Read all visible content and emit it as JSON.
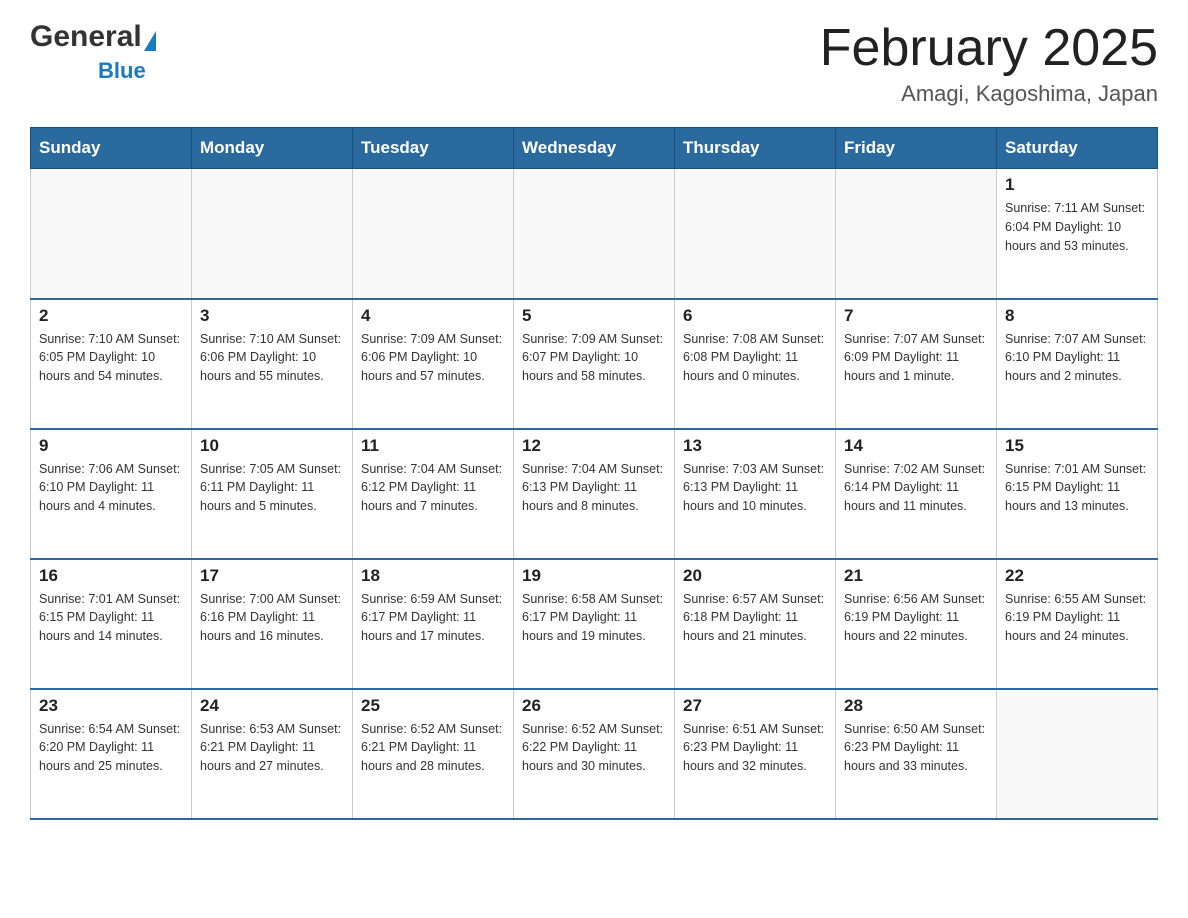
{
  "header": {
    "logo_general": "General",
    "logo_blue": "Blue",
    "title": "February 2025",
    "subtitle": "Amagi, Kagoshima, Japan"
  },
  "weekdays": [
    "Sunday",
    "Monday",
    "Tuesday",
    "Wednesday",
    "Thursday",
    "Friday",
    "Saturday"
  ],
  "weeks": [
    [
      {
        "day": "",
        "info": ""
      },
      {
        "day": "",
        "info": ""
      },
      {
        "day": "",
        "info": ""
      },
      {
        "day": "",
        "info": ""
      },
      {
        "day": "",
        "info": ""
      },
      {
        "day": "",
        "info": ""
      },
      {
        "day": "1",
        "info": "Sunrise: 7:11 AM\nSunset: 6:04 PM\nDaylight: 10 hours\nand 53 minutes."
      }
    ],
    [
      {
        "day": "2",
        "info": "Sunrise: 7:10 AM\nSunset: 6:05 PM\nDaylight: 10 hours\nand 54 minutes."
      },
      {
        "day": "3",
        "info": "Sunrise: 7:10 AM\nSunset: 6:06 PM\nDaylight: 10 hours\nand 55 minutes."
      },
      {
        "day": "4",
        "info": "Sunrise: 7:09 AM\nSunset: 6:06 PM\nDaylight: 10 hours\nand 57 minutes."
      },
      {
        "day": "5",
        "info": "Sunrise: 7:09 AM\nSunset: 6:07 PM\nDaylight: 10 hours\nand 58 minutes."
      },
      {
        "day": "6",
        "info": "Sunrise: 7:08 AM\nSunset: 6:08 PM\nDaylight: 11 hours\nand 0 minutes."
      },
      {
        "day": "7",
        "info": "Sunrise: 7:07 AM\nSunset: 6:09 PM\nDaylight: 11 hours\nand 1 minute."
      },
      {
        "day": "8",
        "info": "Sunrise: 7:07 AM\nSunset: 6:10 PM\nDaylight: 11 hours\nand 2 minutes."
      }
    ],
    [
      {
        "day": "9",
        "info": "Sunrise: 7:06 AM\nSunset: 6:10 PM\nDaylight: 11 hours\nand 4 minutes."
      },
      {
        "day": "10",
        "info": "Sunrise: 7:05 AM\nSunset: 6:11 PM\nDaylight: 11 hours\nand 5 minutes."
      },
      {
        "day": "11",
        "info": "Sunrise: 7:04 AM\nSunset: 6:12 PM\nDaylight: 11 hours\nand 7 minutes."
      },
      {
        "day": "12",
        "info": "Sunrise: 7:04 AM\nSunset: 6:13 PM\nDaylight: 11 hours\nand 8 minutes."
      },
      {
        "day": "13",
        "info": "Sunrise: 7:03 AM\nSunset: 6:13 PM\nDaylight: 11 hours\nand 10 minutes."
      },
      {
        "day": "14",
        "info": "Sunrise: 7:02 AM\nSunset: 6:14 PM\nDaylight: 11 hours\nand 11 minutes."
      },
      {
        "day": "15",
        "info": "Sunrise: 7:01 AM\nSunset: 6:15 PM\nDaylight: 11 hours\nand 13 minutes."
      }
    ],
    [
      {
        "day": "16",
        "info": "Sunrise: 7:01 AM\nSunset: 6:15 PM\nDaylight: 11 hours\nand 14 minutes."
      },
      {
        "day": "17",
        "info": "Sunrise: 7:00 AM\nSunset: 6:16 PM\nDaylight: 11 hours\nand 16 minutes."
      },
      {
        "day": "18",
        "info": "Sunrise: 6:59 AM\nSunset: 6:17 PM\nDaylight: 11 hours\nand 17 minutes."
      },
      {
        "day": "19",
        "info": "Sunrise: 6:58 AM\nSunset: 6:17 PM\nDaylight: 11 hours\nand 19 minutes."
      },
      {
        "day": "20",
        "info": "Sunrise: 6:57 AM\nSunset: 6:18 PM\nDaylight: 11 hours\nand 21 minutes."
      },
      {
        "day": "21",
        "info": "Sunrise: 6:56 AM\nSunset: 6:19 PM\nDaylight: 11 hours\nand 22 minutes."
      },
      {
        "day": "22",
        "info": "Sunrise: 6:55 AM\nSunset: 6:19 PM\nDaylight: 11 hours\nand 24 minutes."
      }
    ],
    [
      {
        "day": "23",
        "info": "Sunrise: 6:54 AM\nSunset: 6:20 PM\nDaylight: 11 hours\nand 25 minutes."
      },
      {
        "day": "24",
        "info": "Sunrise: 6:53 AM\nSunset: 6:21 PM\nDaylight: 11 hours\nand 27 minutes."
      },
      {
        "day": "25",
        "info": "Sunrise: 6:52 AM\nSunset: 6:21 PM\nDaylight: 11 hours\nand 28 minutes."
      },
      {
        "day": "26",
        "info": "Sunrise: 6:52 AM\nSunset: 6:22 PM\nDaylight: 11 hours\nand 30 minutes."
      },
      {
        "day": "27",
        "info": "Sunrise: 6:51 AM\nSunset: 6:23 PM\nDaylight: 11 hours\nand 32 minutes."
      },
      {
        "day": "28",
        "info": "Sunrise: 6:50 AM\nSunset: 6:23 PM\nDaylight: 11 hours\nand 33 minutes."
      },
      {
        "day": "",
        "info": ""
      }
    ]
  ]
}
